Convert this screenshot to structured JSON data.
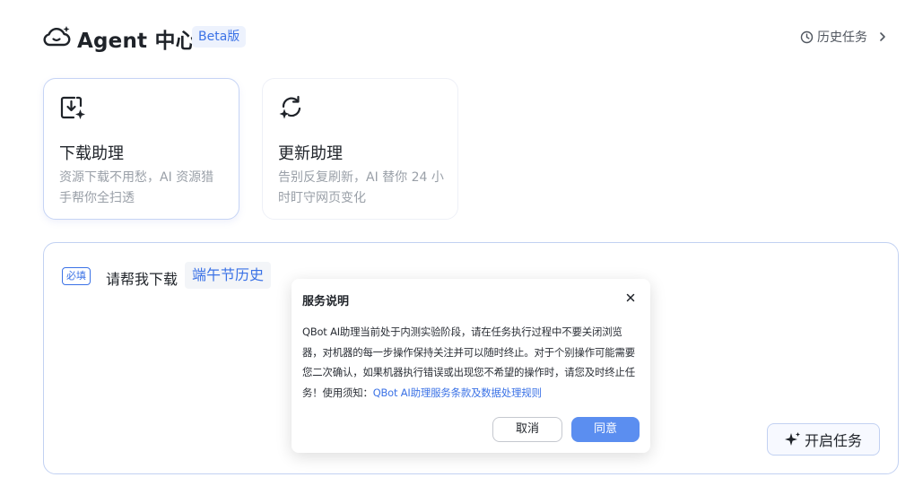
{
  "header": {
    "logo_icon": "cloud-sparkle-icon",
    "title": "Agent 中心",
    "badge": "Beta版",
    "history_icon": "clock-icon",
    "history_label": "历史任务",
    "history_chevron_icon": "chevron-right-icon"
  },
  "cards": [
    {
      "icon": "download-sparkle-icon",
      "title": "下载助理",
      "description": "资源下载不用愁，AI 资源猎手帮你全扫透",
      "selected": true
    },
    {
      "icon": "refresh-sparkle-icon",
      "title": "更新助理",
      "description": "告别反复刷新，AI 替你 24 小时盯守网页变化",
      "selected": false
    }
  ],
  "input": {
    "required_tag": "必填",
    "prompt": "请帮我下载",
    "topic": "端午节历史"
  },
  "start_button": {
    "icon": "sparkle-icon",
    "label": "开启任务"
  },
  "dialog": {
    "title": "服务说明",
    "close_icon": "close-icon",
    "body": "QBot AI助理当前处于内测实验阶段，请在任务执行过程中不要关闭浏览器，对机器的每一步操作保持关注并可以随时终止。对于个别操作可能需要您二次确认，如果机器执行错误或出现您不希望的操作时，请您及时终止任务！使用须知：",
    "link": "QBot AI助理服务条款及数据处理规则",
    "cancel_label": "取消",
    "agree_label": "同意"
  },
  "colors": {
    "accent": "#3b72e6",
    "agree_button": "#5b8ef0",
    "badge_bg": "#edf2fd",
    "card_border_active": "#c6d4f5"
  }
}
